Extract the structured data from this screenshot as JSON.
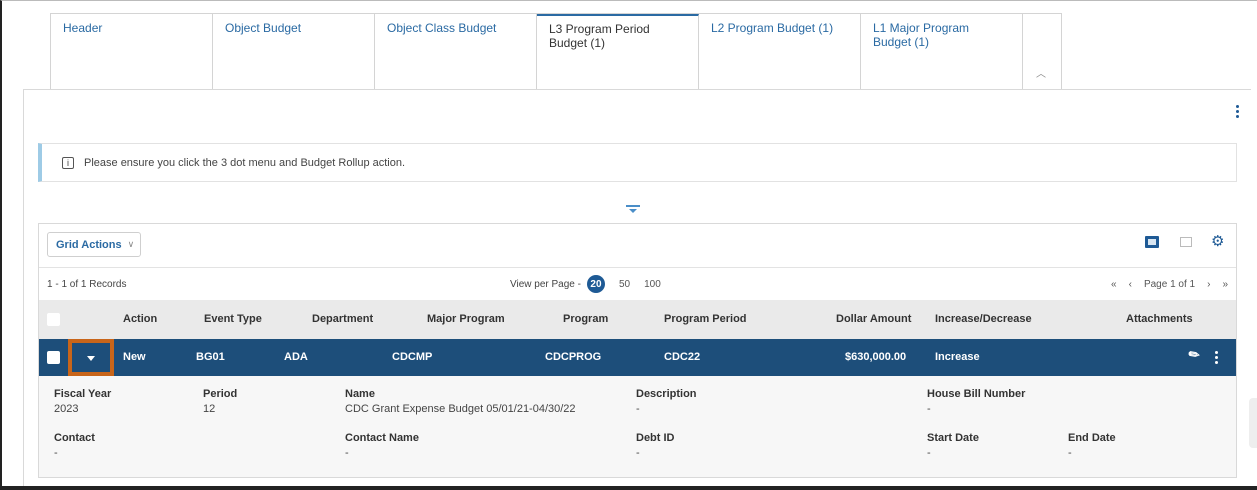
{
  "tabs": [
    {
      "label": "Header"
    },
    {
      "label": "Object Budget"
    },
    {
      "label": "Object Class Budget"
    },
    {
      "label": "L3 Program Period Budget (1)"
    },
    {
      "label": "L2 Program Budget (1)"
    },
    {
      "label": "L1 Major Program Budget (1)"
    }
  ],
  "notice": {
    "text": "Please ensure you click the 3 dot menu and Budget Rollup action."
  },
  "grid": {
    "actions_label": "Grid Actions",
    "records": "1 - 1 of 1 Records",
    "view_per_page_label": "View per Page -",
    "page_sizes": [
      "20",
      "50",
      "100"
    ],
    "page_label": "Page 1 of 1",
    "columns": {
      "action": "Action",
      "event_type": "Event Type",
      "department": "Department",
      "major_program": "Major Program",
      "program": "Program",
      "program_period": "Program Period",
      "dollar_amount": "Dollar Amount",
      "increase_decrease": "Increase/Decrease",
      "attachments": "Attachments"
    },
    "row": {
      "action": "New",
      "event_type": "BG01",
      "department": "ADA",
      "major_program": "CDCMP",
      "program": "CDCPROG",
      "program_period": "CDC22",
      "dollar_amount": "$630,000.00",
      "increase_decrease": "Increase"
    },
    "details": {
      "fiscal_year": {
        "label": "Fiscal Year",
        "value": "2023"
      },
      "period": {
        "label": "Period",
        "value": "12"
      },
      "name": {
        "label": "Name",
        "value": "CDC Grant Expense Budget 05/01/21-04/30/22"
      },
      "description": {
        "label": "Description",
        "value": "-"
      },
      "house_bill_number": {
        "label": "House Bill Number",
        "value": "-"
      },
      "contact": {
        "label": "Contact",
        "value": "-"
      },
      "contact_name": {
        "label": "Contact Name",
        "value": "-"
      },
      "debt_id": {
        "label": "Debt ID",
        "value": "-"
      },
      "start_date": {
        "label": "Start Date",
        "value": "-"
      },
      "end_date": {
        "label": "End Date",
        "value": "-"
      }
    }
  },
  "colors": {
    "accent": "#1e5a95",
    "row_selected": "#1d4e7a",
    "highlight": "#c8651a"
  },
  "icons": [
    "info-icon",
    "collapse-icon",
    "chevron-up-icon",
    "caret-down-icon",
    "grid-view-icon",
    "columns-icon",
    "settings-icon",
    "paperclip-icon",
    "kebab-icon"
  ]
}
